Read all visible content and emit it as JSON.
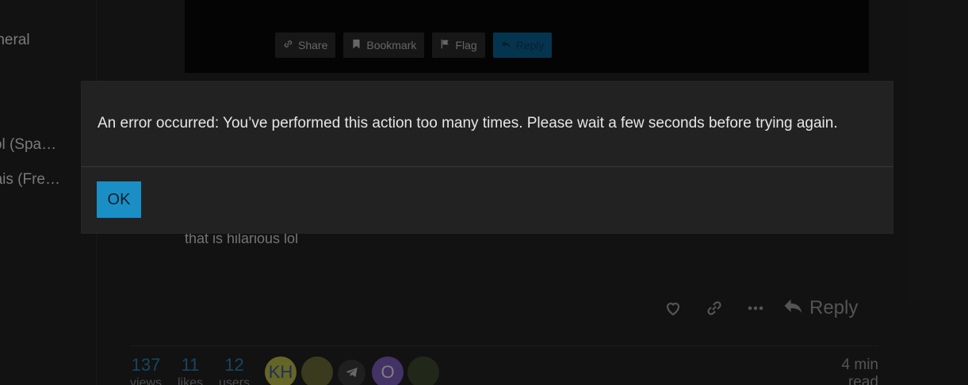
{
  "sidebar": {
    "items": [
      {
        "label": "General"
      },
      {
        "label": "Español (Spanish)"
      },
      {
        "label": "Français (French)"
      }
    ]
  },
  "post": {
    "actions": [
      {
        "label": "Share",
        "icon": "link-icon"
      },
      {
        "label": "Bookmark",
        "icon": "bookmark-icon"
      },
      {
        "label": "Flag",
        "icon": "flag-icon"
      },
      {
        "label": "Reply",
        "icon": "reply-icon"
      }
    ],
    "text": "that is hilarious lol",
    "reply_label": "Reply"
  },
  "topic_map": {
    "stats": [
      {
        "value": "137",
        "label": "views"
      },
      {
        "value": "11",
        "label": "likes"
      },
      {
        "value": "12",
        "label": "users"
      }
    ],
    "avatars": [
      {
        "letter": "KH",
        "color": "#b8b84a"
      },
      {
        "letter": "",
        "color": "#6b6b3a"
      },
      {
        "letter": "",
        "color": "#3a3a3a"
      },
      {
        "letter": "O",
        "color": "#7b5bb8"
      },
      {
        "letter": "",
        "color": "#3c4a2e"
      }
    ],
    "read_time_value": "4 min",
    "read_time_label": "read"
  },
  "dialog": {
    "message": "An error occurred: You’ve performed this action too many times. Please wait a few seconds before trying again.",
    "ok_label": "OK"
  },
  "colors": {
    "accent": "#1a8fc6",
    "background": "#222222"
  }
}
